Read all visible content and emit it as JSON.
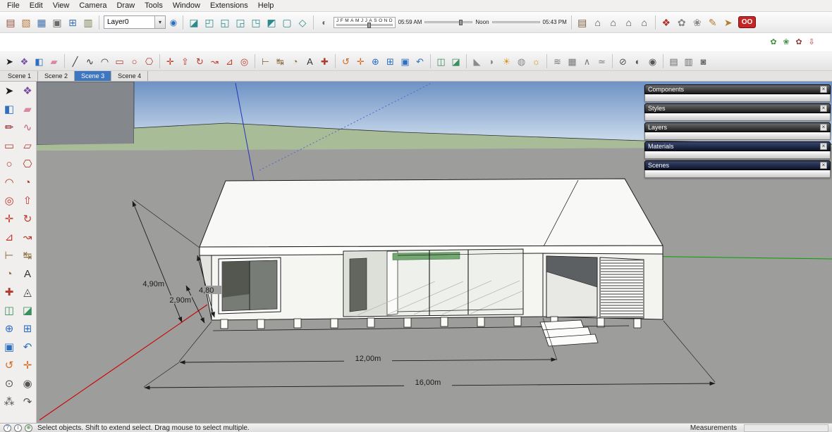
{
  "menu": {
    "items": [
      "File",
      "Edit",
      "View",
      "Camera",
      "Draw",
      "Tools",
      "Window",
      "Extensions",
      "Help"
    ]
  },
  "layers": {
    "selected": "Layer0"
  },
  "shadows": {
    "months": [
      "J",
      "F",
      "M",
      "A",
      "M",
      "J",
      "J",
      "A",
      "S",
      "O",
      "N",
      "D"
    ],
    "time_start": "05:59 AM",
    "time_noon": "Noon",
    "time_end": "05:43 PM"
  },
  "logo_badge": "OO",
  "scene_tabs": [
    {
      "label": "Scene 1",
      "active": false
    },
    {
      "label": "Scene 2",
      "active": false
    },
    {
      "label": "Scene 3",
      "active": true
    },
    {
      "label": "Scene 4",
      "active": false
    }
  ],
  "trays": [
    {
      "title": "Components"
    },
    {
      "title": "Styles"
    },
    {
      "title": "Layers"
    },
    {
      "title": "Materials"
    },
    {
      "title": "Scenes"
    }
  ],
  "viewport": {
    "dim_roof_height": "4,90m",
    "dim_wall_height": "4,80",
    "dim_floor_height": "2,90m",
    "dim_building_length": "12,00m",
    "dim_overall_length": "16,00m"
  },
  "statusbar": {
    "message": "Select objects. Shift to extend select. Drag mouse to select multiple.",
    "measurements_label": "Measurements",
    "measurements_value": ""
  },
  "icons": {
    "close": "×",
    "dropdown-arrow": "▾",
    "layer-manager": "◉",
    "shadow-dialog": "◐",
    "help": "?",
    "credits": "i",
    "geolocate": "⊕"
  },
  "icon_groups": {
    "row1_standard": [
      [
        "new-icon",
        "▤",
        "#9b4a3a"
      ],
      [
        "open-icon",
        "▧",
        "#b5793f"
      ],
      [
        "save-icon",
        "▦",
        "#3f6fae"
      ],
      [
        "print-icon",
        "▣",
        "#6a6a6a"
      ],
      [
        "copy-icon",
        "⊞",
        "#3f6fae"
      ],
      [
        "paste-icon",
        "▥",
        "#7d7d52"
      ]
    ],
    "row1_views": [
      [
        "iso-view-icon",
        "◪",
        "#2e8b8b"
      ],
      [
        "top-view-icon",
        "◰",
        "#2e8b8b"
      ],
      [
        "front-view-icon",
        "◱",
        "#2e8b8b"
      ],
      [
        "right-view-icon",
        "◲",
        "#2e8b8b"
      ],
      [
        "back-view-icon",
        "◳",
        "#2e8b8b"
      ],
      [
        "left-view-icon",
        "◩",
        "#2e8b8b"
      ],
      [
        "bottom-view-icon",
        "▢",
        "#2e8b8b"
      ],
      [
        "perspective-view-icon",
        "◇",
        "#2e8b8b"
      ]
    ],
    "row1_places": [
      [
        "instructor-icon",
        "▤",
        "#7a5c3a"
      ],
      [
        "component-house-1-icon",
        "⌂",
        "#4a4a4a"
      ],
      [
        "component-house-2-icon",
        "⌂",
        "#4a4a4a"
      ],
      [
        "component-house-3-icon",
        "⌂",
        "#4a4a4a"
      ],
      [
        "component-house-4-icon",
        "⌂",
        "#4a4a4a"
      ]
    ],
    "row1_plugins": [
      [
        "plugin-people-icon",
        "❖",
        "#b03030"
      ],
      [
        "plugin-flower-icon",
        "✿",
        "#888888"
      ],
      [
        "plugin-burst-icon",
        "❀",
        "#888888"
      ],
      [
        "plugin-pencil-icon",
        "✎",
        "#b08030"
      ],
      [
        "plugin-arrow-icon",
        "➤",
        "#b08030"
      ]
    ],
    "gap_right": [
      [
        "vegetation-1-icon",
        "✿",
        "#3f8f3f"
      ],
      [
        "vegetation-2-icon",
        "❀",
        "#3f8f3f"
      ],
      [
        "vegetation-3-icon",
        "✿",
        "#8f3f3f"
      ],
      [
        "download-icon",
        "⇩",
        "#b03030"
      ]
    ],
    "row2_principal": [
      [
        "select-icon",
        "➤",
        "#1c1c1c"
      ],
      [
        "make-component-icon",
        "❖",
        "#7a4e9e"
      ],
      [
        "paint-bucket-icon",
        "◧",
        "#2f6fbf"
      ],
      [
        "eraser-icon",
        "▰",
        "#d98aa0"
      ]
    ],
    "row2_draw": [
      [
        "line-icon",
        "╱",
        "#333333"
      ],
      [
        "freehand-icon",
        "∿",
        "#333333"
      ],
      [
        "arc-icon",
        "◠",
        "#333333"
      ],
      [
        "rectangle-icon",
        "▭",
        "#b03a2e"
      ],
      [
        "circle-icon",
        "○",
        "#b03a2e"
      ],
      [
        "polygon-icon",
        "⎔",
        "#b03a2e"
      ]
    ],
    "row2_edit": [
      [
        "move-icon",
        "✛",
        "#c0392b"
      ],
      [
        "push-pull-icon",
        "⇧",
        "#c0392b"
      ],
      [
        "rotate-icon",
        "↻",
        "#c0392b"
      ],
      [
        "follow-me-icon",
        "↝",
        "#c0392b"
      ],
      [
        "scale-icon",
        "⊿",
        "#c0392b"
      ],
      [
        "offset-icon",
        "◎",
        "#c0392b"
      ]
    ],
    "row2_construction": [
      [
        "tape-measure-icon",
        "⊢",
        "#8a6d3b"
      ],
      [
        "dimension-icon",
        "↹",
        "#8a6d3b"
      ],
      [
        "protractor-icon",
        "◔",
        "#8a6d3b"
      ],
      [
        "text-icon",
        "A",
        "#333333"
      ],
      [
        "axes-icon",
        "✚",
        "#b03a2e"
      ]
    ],
    "row2_camera": [
      [
        "orbit-icon",
        "↺",
        "#d2691e"
      ],
      [
        "pan-icon",
        "✛",
        "#d2691e"
      ],
      [
        "zoom-icon",
        "⊕",
        "#2f6fbf"
      ],
      [
        "zoom-window-icon",
        "⊞",
        "#2f6fbf"
      ],
      [
        "zoom-extents-icon",
        "▣",
        "#2f6fbf"
      ],
      [
        "previous-icon",
        "↶",
        "#2f6fbf"
      ]
    ],
    "row2_section": [
      [
        "section-plane-icon",
        "◫",
        "#3a8f5f"
      ],
      [
        "section-cut-icon",
        "◪",
        "#3a8f5f"
      ]
    ],
    "row2_atmosphere": [
      [
        "shadow-cone-icon",
        "◣",
        "#8a8a8a"
      ],
      [
        "face-lens-icon",
        "◗",
        "#8a8a8a"
      ],
      [
        "sun-icon",
        "☀",
        "#d89a20"
      ],
      [
        "sphere-icon",
        "◍",
        "#8a8a8a"
      ],
      [
        "daylight-icon",
        "☼",
        "#d89a20"
      ]
    ],
    "row2_sandbox": [
      [
        "sandbox-contours-icon",
        "≋",
        "#777777"
      ],
      [
        "sandbox-scratch-icon",
        "▦",
        "#777777"
      ],
      [
        "smoove-icon",
        "∧",
        "#777777"
      ],
      [
        "stamp-icon",
        "≃",
        "#777777"
      ]
    ],
    "row2_styles": [
      [
        "xray-icon",
        "⊘",
        "#555555"
      ],
      [
        "shaded-toggle-icon",
        "◐",
        "#555555"
      ],
      [
        "texture-toggle-icon",
        "◉",
        "#555555"
      ]
    ],
    "row2_dialogs": [
      [
        "entity-info-icon",
        "▤",
        "#6a6a6a"
      ],
      [
        "model-info-icon",
        "▥",
        "#6a6a6a"
      ],
      [
        "lock-icon",
        "◙",
        "#6a6a6a"
      ]
    ],
    "left_tools": [
      [
        "select-icon",
        "➤",
        "#1c1c1c"
      ],
      [
        "make-component-icon",
        "❖",
        "#7a4e9e"
      ],
      [
        "paint-bucket-icon",
        "◧",
        "#2f6fbf"
      ],
      [
        "eraser-icon",
        "▰",
        "#d98aa0"
      ],
      [
        "line-icon",
        "✏",
        "#8b1a1a"
      ],
      [
        "freehand-icon",
        "∿",
        "#c06080"
      ],
      [
        "rectangle-icon",
        "▭",
        "#b03a2e"
      ],
      [
        "rotated-rectangle-icon",
        "▱",
        "#b03a2e"
      ],
      [
        "circle-icon",
        "○",
        "#b03a2e"
      ],
      [
        "polygon-icon",
        "⎔",
        "#b03a2e"
      ],
      [
        "arc-icon",
        "◠",
        "#b03a2e"
      ],
      [
        "pie-icon",
        "◔",
        "#b03a2e"
      ],
      [
        "offset-icon",
        "◎",
        "#c0392b"
      ],
      [
        "push-pull-icon",
        "⇧",
        "#c0392b"
      ],
      [
        "move-icon",
        "✛",
        "#c0392b"
      ],
      [
        "rotate-icon",
        "↻",
        "#c0392b"
      ],
      [
        "scale-icon",
        "⊿",
        "#c0392b"
      ],
      [
        "follow-me-icon",
        "↝",
        "#c0392b"
      ],
      [
        "tape-measure-icon",
        "⊢",
        "#8a6d3b"
      ],
      [
        "dimension-icon",
        "↹",
        "#8a6d3b"
      ],
      [
        "protractor-icon",
        "◔",
        "#8a6d3b"
      ],
      [
        "text-icon",
        "A",
        "#333333"
      ],
      [
        "axes-icon",
        "✚",
        "#b03a2e"
      ],
      [
        "3d-text-icon",
        "◬",
        "#444444"
      ],
      [
        "section-plane-icon",
        "◫",
        "#3a8f5f"
      ],
      [
        "section-cut-icon",
        "◪",
        "#3a8f5f"
      ],
      [
        "zoom-icon",
        "⊕",
        "#2f6fbf"
      ],
      [
        "zoom-window-icon",
        "⊞",
        "#2f6fbf"
      ],
      [
        "zoom-extents-icon",
        "▣",
        "#2f6fbf"
      ],
      [
        "previous-icon",
        "↶",
        "#2f6fbf"
      ],
      [
        "orbit-icon",
        "↺",
        "#d2691e"
      ],
      [
        "pan-icon",
        "✛",
        "#d2691e"
      ],
      [
        "position-camera-icon",
        "⊙",
        "#555555"
      ],
      [
        "look-around-icon",
        "◉",
        "#555555"
      ],
      [
        "walk-icon",
        "⁂",
        "#555555"
      ],
      [
        "next-icon",
        "↷",
        "#555555"
      ]
    ]
  }
}
